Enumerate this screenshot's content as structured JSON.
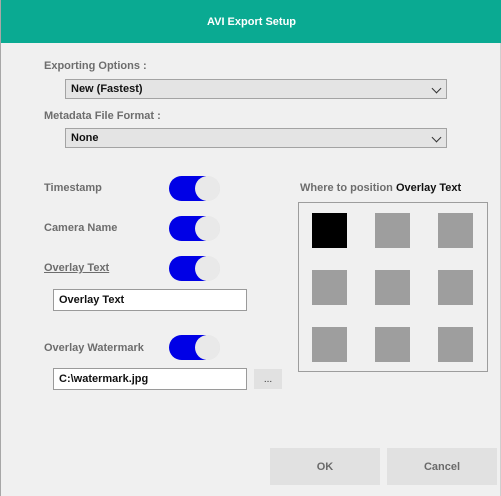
{
  "window": {
    "title": "AVI Export Setup"
  },
  "exporting": {
    "label": "Exporting Options :",
    "value": "New (Fastest)"
  },
  "metadata": {
    "label": "Metadata File Format :",
    "value": "None"
  },
  "toggles": {
    "timestamp": {
      "label": "Timestamp",
      "on": true
    },
    "camera_name": {
      "label": "Camera Name",
      "on": true
    },
    "overlay_text": {
      "label": "Overlay Text",
      "on": true,
      "value": "Overlay Text"
    },
    "overlay_watermark": {
      "label": "Overlay Watermark",
      "on": true,
      "value": "C:\\watermark.jpg",
      "browse_label": "..."
    }
  },
  "position": {
    "heading_prefix": "Where to position ",
    "heading_bold": "Overlay Text",
    "selected": "top-left"
  },
  "buttons": {
    "ok": "OK",
    "cancel": "Cancel"
  },
  "colors": {
    "title_bar": "#0aaa92",
    "toggle_on": "#0000e6",
    "selected_cell": "#000000",
    "cell": "#9e9e9e"
  }
}
